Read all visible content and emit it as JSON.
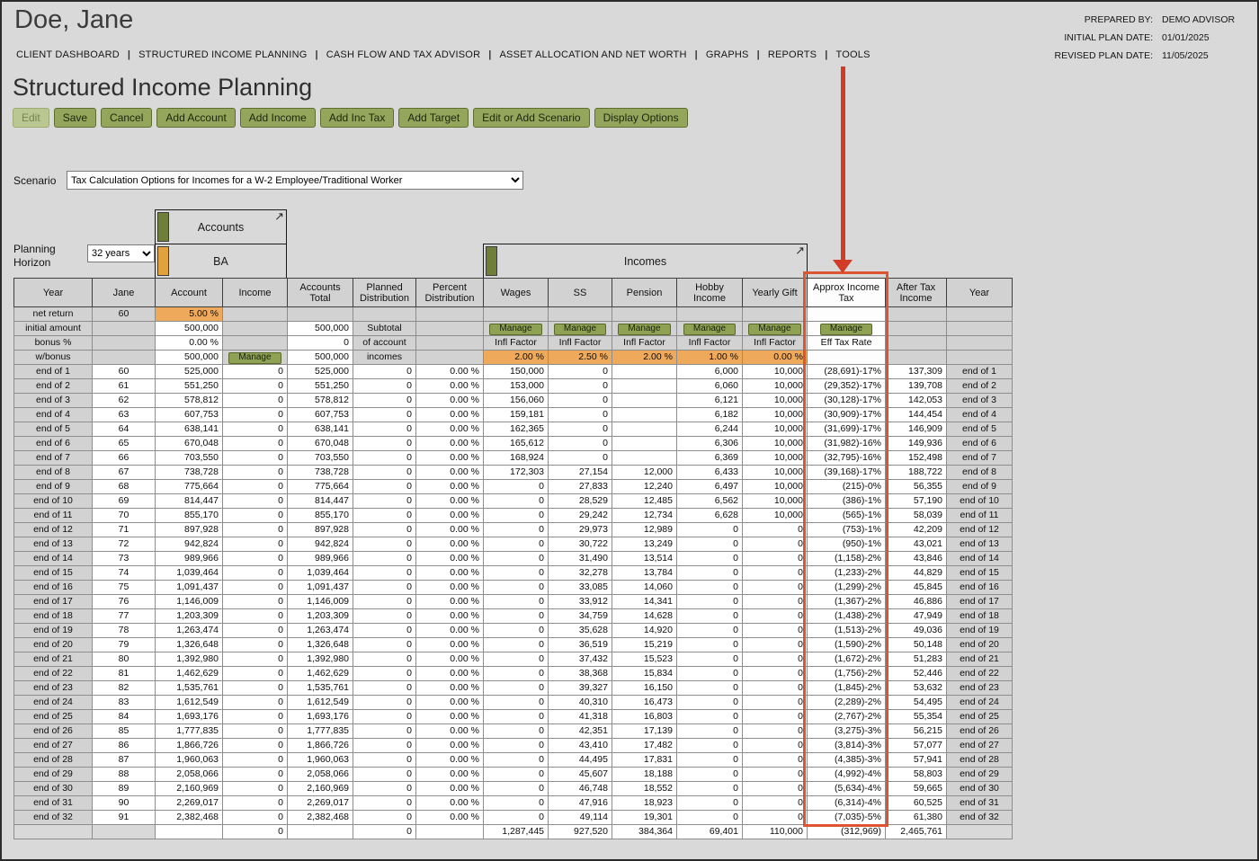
{
  "header": {
    "client_name": "Doe, Jane"
  },
  "plan_info": {
    "prepared_by_label": "PREPARED BY:",
    "prepared_by": "DEMO ADVISOR",
    "initial_plan_date_label": "INITIAL PLAN DATE:",
    "initial_plan_date": "01/01/2025",
    "revised_plan_date_label": "REVISED PLAN DATE:",
    "revised_plan_date": "11/05/2025"
  },
  "nav": {
    "items": [
      "CLIENT DASHBOARD",
      "STRUCTURED INCOME PLANNING",
      "CASH FLOW AND TAX ADVISOR",
      "ASSET ALLOCATION AND NET WORTH",
      "GRAPHS",
      "REPORTS",
      "TOOLS"
    ]
  },
  "page": {
    "title": "Structured Income Planning"
  },
  "toolbar": {
    "buttons": [
      {
        "label": "Edit",
        "disabled": true
      },
      {
        "label": "Save"
      },
      {
        "label": "Cancel"
      },
      {
        "label": "Add Account"
      },
      {
        "label": "Add Income"
      },
      {
        "label": "Add Inc Tax"
      },
      {
        "label": "Add Target"
      },
      {
        "label": "Edit or Add Scenario"
      },
      {
        "label": "Display Options"
      }
    ]
  },
  "scenario": {
    "label": "Scenario",
    "selected": "Tax Calculation Options for Incomes for a W-2 Employee/Traditional Worker"
  },
  "planning_horizon": {
    "label": "Planning Horizon",
    "selected": "32 years"
  },
  "sections": {
    "accounts": {
      "title": "Accounts"
    },
    "ba": {
      "title": "BA"
    },
    "incomes": {
      "title": "Incomes"
    }
  },
  "table": {
    "headers": [
      "Year",
      "Jane",
      "Account",
      "Income",
      "Accounts Total",
      "Planned Distribution",
      "Percent Distribution",
      "Wages",
      "SS",
      "Pension",
      "Hobby Income",
      "Yearly Gift",
      "Approx Income Tax",
      "After Tax Income",
      "Year"
    ],
    "setup": {
      "net_return_label": "net return",
      "age": "60",
      "net_return_rate": "5.00 %",
      "initial_amount_label": "initial amount",
      "initial_amount": "500,000",
      "accounts_total_initial": "500,000",
      "subtotal_text_1": "Subtotal",
      "bonus_label": "bonus %",
      "bonus_rate": "0.00 %",
      "accounts_total_bonus": "0",
      "subtotal_text_2": "of account",
      "wbonus_label": "w/bonus",
      "wbonus_amount": "500,000",
      "accounts_total_wbonus": "500,000",
      "subtotal_text_3": "incomes",
      "manage_label": "Manage",
      "infl_factor_label": "Infl Factor",
      "eff_tax_rate_label": "Eff Tax Rate",
      "infl_rates": {
        "wages": "2.00 %",
        "ss": "2.50 %",
        "pension": "2.00 %",
        "hobby": "1.00 %",
        "gift": "0.00 %"
      }
    },
    "rows": [
      [
        "end of 1",
        "60",
        "525,000",
        "0",
        "525,000",
        "0",
        "0.00 %",
        "150,000",
        "0",
        "",
        "6,000",
        "10,000",
        "(28,691)-17%",
        "137,309",
        "end of 1"
      ],
      [
        "end of 2",
        "61",
        "551,250",
        "0",
        "551,250",
        "0",
        "0.00 %",
        "153,000",
        "0",
        "",
        "6,060",
        "10,000",
        "(29,352)-17%",
        "139,708",
        "end of 2"
      ],
      [
        "end of 3",
        "62",
        "578,812",
        "0",
        "578,812",
        "0",
        "0.00 %",
        "156,060",
        "0",
        "",
        "6,121",
        "10,000",
        "(30,128)-17%",
        "142,053",
        "end of 3"
      ],
      [
        "end of 4",
        "63",
        "607,753",
        "0",
        "607,753",
        "0",
        "0.00 %",
        "159,181",
        "0",
        "",
        "6,182",
        "10,000",
        "(30,909)-17%",
        "144,454",
        "end of 4"
      ],
      [
        "end of 5",
        "64",
        "638,141",
        "0",
        "638,141",
        "0",
        "0.00 %",
        "162,365",
        "0",
        "",
        "6,244",
        "10,000",
        "(31,699)-17%",
        "146,909",
        "end of 5"
      ],
      [
        "end of 6",
        "65",
        "670,048",
        "0",
        "670,048",
        "0",
        "0.00 %",
        "165,612",
        "0",
        "",
        "6,306",
        "10,000",
        "(31,982)-16%",
        "149,936",
        "end of 6"
      ],
      [
        "end of 7",
        "66",
        "703,550",
        "0",
        "703,550",
        "0",
        "0.00 %",
        "168,924",
        "0",
        "",
        "6,369",
        "10,000",
        "(32,795)-16%",
        "152,498",
        "end of 7"
      ],
      [
        "end of 8",
        "67",
        "738,728",
        "0",
        "738,728",
        "0",
        "0.00 %",
        "172,303",
        "27,154",
        "12,000",
        "6,433",
        "10,000",
        "(39,168)-17%",
        "188,722",
        "end of 8"
      ],
      [
        "end of 9",
        "68",
        "775,664",
        "0",
        "775,664",
        "0",
        "0.00 %",
        "0",
        "27,833",
        "12,240",
        "6,497",
        "10,000",
        "(215)-0%",
        "56,355",
        "end of 9"
      ],
      [
        "end of 10",
        "69",
        "814,447",
        "0",
        "814,447",
        "0",
        "0.00 %",
        "0",
        "28,529",
        "12,485",
        "6,562",
        "10,000",
        "(386)-1%",
        "57,190",
        "end of 10"
      ],
      [
        "end of 11",
        "70",
        "855,170",
        "0",
        "855,170",
        "0",
        "0.00 %",
        "0",
        "29,242",
        "12,734",
        "6,628",
        "10,000",
        "(565)-1%",
        "58,039",
        "end of 11"
      ],
      [
        "end of 12",
        "71",
        "897,928",
        "0",
        "897,928",
        "0",
        "0.00 %",
        "0",
        "29,973",
        "12,989",
        "0",
        "0",
        "(753)-1%",
        "42,209",
        "end of 12"
      ],
      [
        "end of 13",
        "72",
        "942,824",
        "0",
        "942,824",
        "0",
        "0.00 %",
        "0",
        "30,722",
        "13,249",
        "0",
        "0",
        "(950)-1%",
        "43,021",
        "end of 13"
      ],
      [
        "end of 14",
        "73",
        "989,966",
        "0",
        "989,966",
        "0",
        "0.00 %",
        "0",
        "31,490",
        "13,514",
        "0",
        "0",
        "(1,158)-2%",
        "43,846",
        "end of 14"
      ],
      [
        "end of 15",
        "74",
        "1,039,464",
        "0",
        "1,039,464",
        "0",
        "0.00 %",
        "0",
        "32,278",
        "13,784",
        "0",
        "0",
        "(1,233)-2%",
        "44,829",
        "end of 15"
      ],
      [
        "end of 16",
        "75",
        "1,091,437",
        "0",
        "1,091,437",
        "0",
        "0.00 %",
        "0",
        "33,085",
        "14,060",
        "0",
        "0",
        "(1,299)-2%",
        "45,845",
        "end of 16"
      ],
      [
        "end of 17",
        "76",
        "1,146,009",
        "0",
        "1,146,009",
        "0",
        "0.00 %",
        "0",
        "33,912",
        "14,341",
        "0",
        "0",
        "(1,367)-2%",
        "46,886",
        "end of 17"
      ],
      [
        "end of 18",
        "77",
        "1,203,309",
        "0",
        "1,203,309",
        "0",
        "0.00 %",
        "0",
        "34,759",
        "14,628",
        "0",
        "0",
        "(1,438)-2%",
        "47,949",
        "end of 18"
      ],
      [
        "end of 19",
        "78",
        "1,263,474",
        "0",
        "1,263,474",
        "0",
        "0.00 %",
        "0",
        "35,628",
        "14,920",
        "0",
        "0",
        "(1,513)-2%",
        "49,036",
        "end of 19"
      ],
      [
        "end of 20",
        "79",
        "1,326,648",
        "0",
        "1,326,648",
        "0",
        "0.00 %",
        "0",
        "36,519",
        "15,219",
        "0",
        "0",
        "(1,590)-2%",
        "50,148",
        "end of 20"
      ],
      [
        "end of 21",
        "80",
        "1,392,980",
        "0",
        "1,392,980",
        "0",
        "0.00 %",
        "0",
        "37,432",
        "15,523",
        "0",
        "0",
        "(1,672)-2%",
        "51,283",
        "end of 21"
      ],
      [
        "end of 22",
        "81",
        "1,462,629",
        "0",
        "1,462,629",
        "0",
        "0.00 %",
        "0",
        "38,368",
        "15,834",
        "0",
        "0",
        "(1,756)-2%",
        "52,446",
        "end of 22"
      ],
      [
        "end of 23",
        "82",
        "1,535,761",
        "0",
        "1,535,761",
        "0",
        "0.00 %",
        "0",
        "39,327",
        "16,150",
        "0",
        "0",
        "(1,845)-2%",
        "53,632",
        "end of 23"
      ],
      [
        "end of 24",
        "83",
        "1,612,549",
        "0",
        "1,612,549",
        "0",
        "0.00 %",
        "0",
        "40,310",
        "16,473",
        "0",
        "0",
        "(2,289)-2%",
        "54,495",
        "end of 24"
      ],
      [
        "end of 25",
        "84",
        "1,693,176",
        "0",
        "1,693,176",
        "0",
        "0.00 %",
        "0",
        "41,318",
        "16,803",
        "0",
        "0",
        "(2,767)-2%",
        "55,354",
        "end of 25"
      ],
      [
        "end of 26",
        "85",
        "1,777,835",
        "0",
        "1,777,835",
        "0",
        "0.00 %",
        "0",
        "42,351",
        "17,139",
        "0",
        "0",
        "(3,275)-3%",
        "56,215",
        "end of 26"
      ],
      [
        "end of 27",
        "86",
        "1,866,726",
        "0",
        "1,866,726",
        "0",
        "0.00 %",
        "0",
        "43,410",
        "17,482",
        "0",
        "0",
        "(3,814)-3%",
        "57,077",
        "end of 27"
      ],
      [
        "end of 28",
        "87",
        "1,960,063",
        "0",
        "1,960,063",
        "0",
        "0.00 %",
        "0",
        "44,495",
        "17,831",
        "0",
        "0",
        "(4,385)-3%",
        "57,941",
        "end of 28"
      ],
      [
        "end of 29",
        "88",
        "2,058,066",
        "0",
        "2,058,066",
        "0",
        "0.00 %",
        "0",
        "45,607",
        "18,188",
        "0",
        "0",
        "(4,992)-4%",
        "58,803",
        "end of 29"
      ],
      [
        "end of 30",
        "89",
        "2,160,969",
        "0",
        "2,160,969",
        "0",
        "0.00 %",
        "0",
        "46,748",
        "18,552",
        "0",
        "0",
        "(5,634)-4%",
        "59,665",
        "end of 30"
      ],
      [
        "end of 31",
        "90",
        "2,269,017",
        "0",
        "2,269,017",
        "0",
        "0.00 %",
        "0",
        "47,916",
        "18,923",
        "0",
        "0",
        "(6,314)-4%",
        "60,525",
        "end of 31"
      ],
      [
        "end of 32",
        "91",
        "2,382,468",
        "0",
        "2,382,468",
        "0",
        "0.00 %",
        "0",
        "49,114",
        "19,301",
        "0",
        "0",
        "(7,035)-5%",
        "61,380",
        "end of 32"
      ]
    ],
    "totals": [
      "",
      "",
      "",
      "0",
      "",
      "0",
      "",
      "1,287,445",
      "927,520",
      "384,364",
      "69,401",
      "110,000",
      "(312,969)",
      "2,465,761",
      ""
    ]
  },
  "colors": {
    "button_green": "#94a55c",
    "marker_green": "#6f7f3a",
    "marker_orange": "#e2a23b",
    "rate_cell_orange": "#efa95a",
    "highlight_border": "#df5430",
    "arrow_red": "#d23b25"
  }
}
